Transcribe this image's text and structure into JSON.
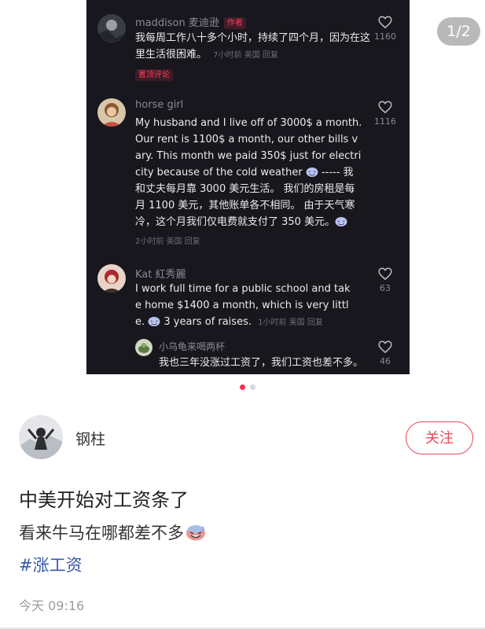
{
  "pager": {
    "label": "1/2"
  },
  "comments": [
    {
      "username": "maddison 麦迪逊",
      "author_tag": "作者",
      "text": "我每周工作八十多个小时，持续了四个月，因为在这里生活很困难。",
      "meta": "7小时前 美国 回复",
      "pinned_tag": "置顶评论",
      "likes": "1160",
      "avatar_icon": "dark-avatar"
    },
    {
      "username": "horse girl",
      "text_before_emoji": "My husband and I live off of 3000$ a month. Our rent is 1100$ a month, our other bills vary. This month we paid 350$ just for electricity because of the cold weather ",
      "text_mid": " -----  我和丈夫每月靠 3000 美元生活。 我们的房租是每月 1100 美元，其他账单各不相同。 由于天气寒冷，这个月我们仅电费就支付了 350 美元。",
      "meta": "2小时前 美国 回复",
      "likes": "1116",
      "avatar_icon": "girl-avatar"
    },
    {
      "username": "Kat 紅秀麗",
      "text_before_emoji": "I work full time for a public school and take home $1400 a month, which is very little. ",
      "text_after_emoji": " 3 years of raises.",
      "meta": "1小时前 美国 回复",
      "likes": "63",
      "avatar_icon": "kat-avatar"
    },
    {
      "username": "小乌龟来喝两杯",
      "text": "我也三年没涨过工资了，我们工资也差不多。",
      "likes": "46",
      "avatar_icon": "turtle-avatar"
    }
  ],
  "carousel": {
    "active_color": "#ff2c55",
    "inactive_color": "#d8d8d8"
  },
  "author": {
    "name": "钢柱",
    "follow_label": "关注",
    "accent": "#e9485b"
  },
  "post": {
    "title": "中美开始对工资条了",
    "body": "看来牛马在哪都差不多",
    "tag": "#涨工资",
    "time": "今天 09:16"
  },
  "icons": {
    "like": "heart-outline-icon",
    "emoji": "sweat-smile-emoji-icon"
  }
}
